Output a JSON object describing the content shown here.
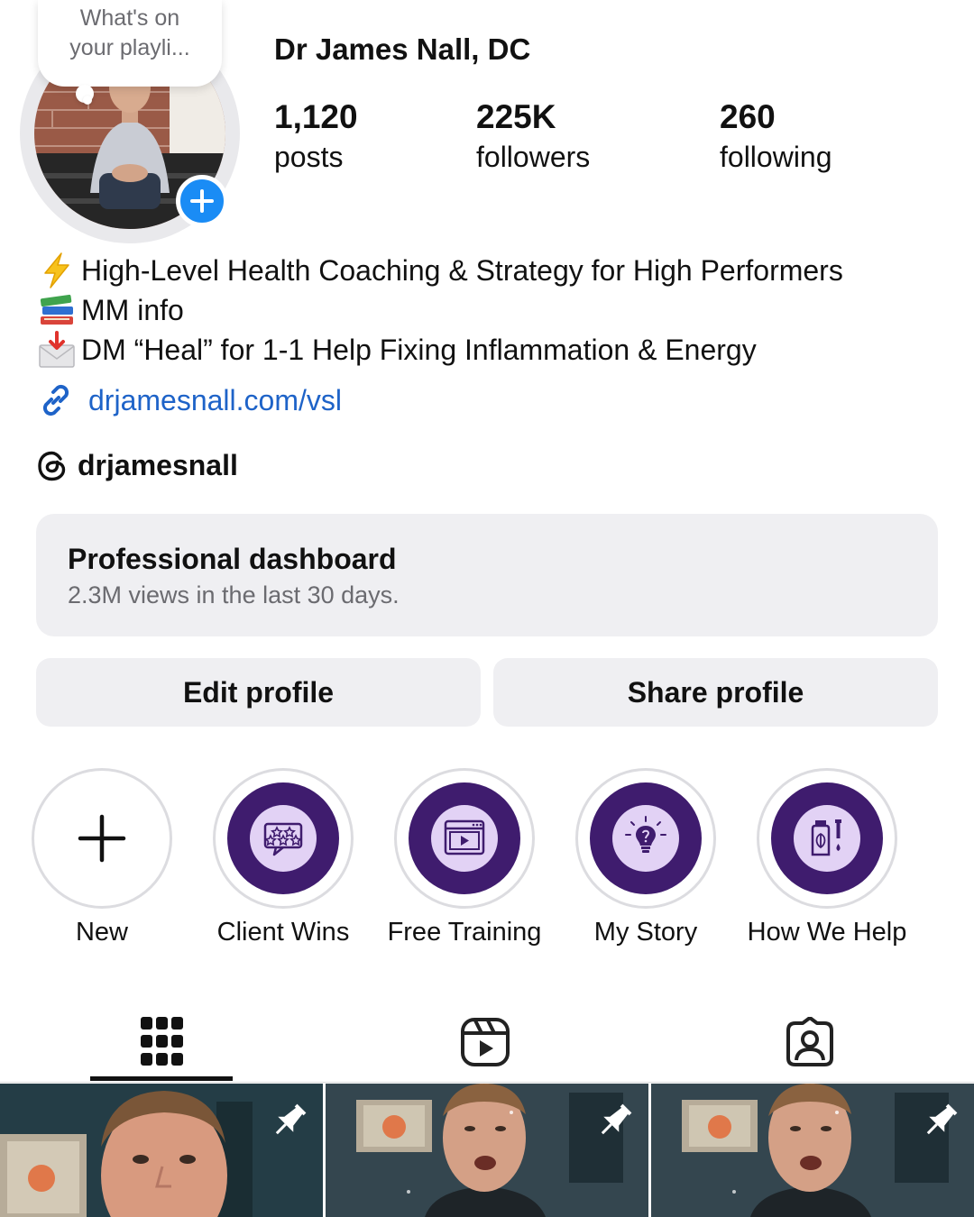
{
  "profile": {
    "note": {
      "line1": "What's on",
      "line2": "your playli..."
    },
    "display_name": "Dr James Nall, DC",
    "stats": [
      {
        "value": "1,120",
        "label": "posts"
      },
      {
        "value": "225K",
        "label": "followers"
      },
      {
        "value": "260",
        "label": "following"
      }
    ],
    "bio": [
      {
        "icon": "lightning-emoji",
        "text": "High-Level Health Coaching & Strategy for High Performers"
      },
      {
        "icon": "books-emoji",
        "text": "MM info"
      },
      {
        "icon": "envelope-arrow-emoji",
        "text": "DM “Heal” for 1-1 Help Fixing Inflammation & Energy"
      }
    ],
    "link": {
      "icon": "link-icon",
      "text": "drjamesnall.com/vsl"
    },
    "threads": {
      "icon": "threads-icon",
      "handle": "drjamesnall"
    }
  },
  "dashboard": {
    "title": "Professional dashboard",
    "subtitle": "2.3M views in the last 30 days."
  },
  "buttons": {
    "edit": "Edit profile",
    "share": "Share profile"
  },
  "highlights": [
    {
      "label": "New",
      "icon": "plus-icon"
    },
    {
      "label": "Client Wins",
      "icon": "review-stars-icon"
    },
    {
      "label": "Free Training",
      "icon": "video-player-icon"
    },
    {
      "label": "My Story",
      "icon": "lightbulb-icon"
    },
    {
      "label": "How We Help",
      "icon": "supplement-bottle-icon"
    }
  ],
  "tabs": [
    {
      "icon": "grid-icon",
      "active": true
    },
    {
      "icon": "reels-icon",
      "active": false
    },
    {
      "icon": "tagged-icon",
      "active": false
    }
  ],
  "posts": [
    {
      "pinned": true,
      "icon": "pin-icon"
    },
    {
      "pinned": true,
      "icon": "pin-icon"
    },
    {
      "pinned": true,
      "icon": "pin-icon"
    }
  ],
  "colors": {
    "link": "#1e63c8",
    "add_story": "#1a8cf5",
    "highlight_cover": "#3f1c6e",
    "highlight_icon_bg": "#e2d2f5",
    "button_bg": "#efeff2"
  }
}
